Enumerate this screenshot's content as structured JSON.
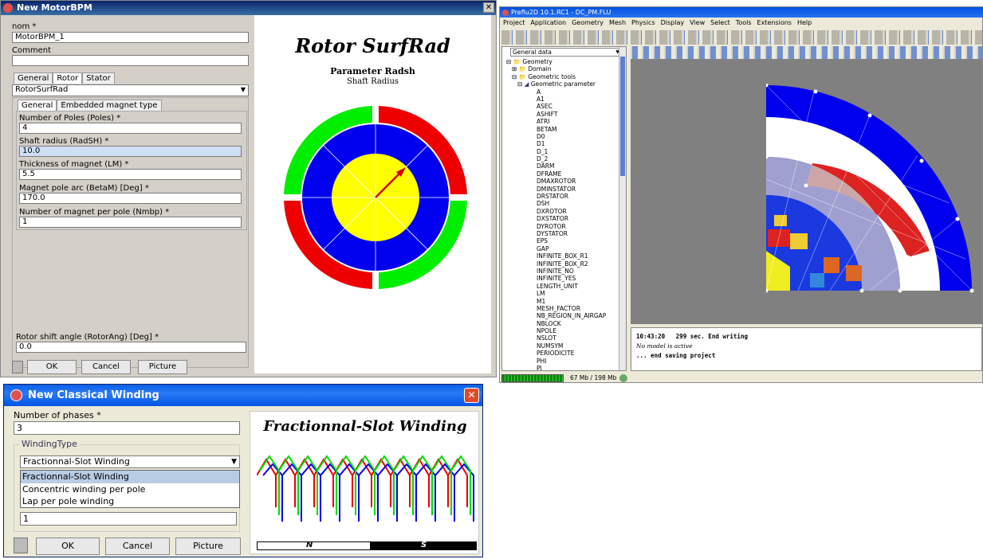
{
  "motor_dialog": {
    "title": "New MotorBPM",
    "nom_label": "nom *",
    "nom_value": "MotorBPM_1",
    "comment_label": "Comment",
    "comment_value": "",
    "tabs": [
      "General",
      "Rotor",
      "Stator"
    ],
    "rotor_type": "RotorSurfRad",
    "subtabs": [
      "General",
      "Embedded magnet type"
    ],
    "fields": [
      {
        "label": "Number of Poles (Poles) *",
        "value": "4"
      },
      {
        "label": "Shaft radius (RadSH) *",
        "value": "10.0"
      },
      {
        "label": "Thickness of magnet (LM) *",
        "value": "5.5"
      },
      {
        "label": "Magnet pole arc (BetaM) [Deg] *",
        "value": "170.0"
      },
      {
        "label": "Number of magnet per pole (Nmbp) *",
        "value": "1"
      }
    ],
    "shift_label": "Rotor shift angle (RotorAng) [Deg] *",
    "shift_value": "0.0",
    "ok": "OK",
    "cancel": "Cancel",
    "picture": "Picture",
    "preview_title": "Rotor SurfRad",
    "param_title": "Parameter Radsh",
    "param_sub": "Shaft Radius",
    "colors": {
      "red": "#ee0000",
      "green": "#00ee00",
      "blue": "#0000ee",
      "yellow": "#ffff00"
    }
  },
  "preflu": {
    "title": "Preflu2D 10.1.RC1 - DC_PM.FLU",
    "menu": [
      "Project",
      "Application",
      "Geometry",
      "Mesh",
      "Physics",
      "Display",
      "View",
      "Select",
      "Tools",
      "Extensions",
      "Help"
    ],
    "tree_header": "General data",
    "tree_top": [
      "Geometry",
      "Domain",
      "Geometric tools",
      "Geometric parameter"
    ],
    "params": [
      "A",
      "A1",
      "ASEC",
      "ASHIFT",
      "ATRI",
      "BETAM",
      "D0",
      "D1",
      "D_1",
      "D_2",
      "DARM",
      "DFRAME",
      "DMAXROTOR",
      "DMINSTATOR",
      "DRSTATOR",
      "DSH",
      "DXROTOR",
      "DXSTATOR",
      "DYROTOR",
      "DYSTATOR",
      "EPS",
      "GAP",
      "INFINITE_BOX_R1",
      "INFINITE_BOX_R2",
      "INFINITE_NO",
      "INFINITE_YES",
      "LENGTH_UNIT",
      "LM",
      "M1",
      "MESH_FACTOR",
      "NB_REGION_IN_AIRGAP",
      "NBLOCK",
      "NPOLE",
      "NSLOT",
      "NUMSYM",
      "PERIODICITE",
      "PHI",
      "PI"
    ],
    "console": [
      {
        "time": "10:43:20",
        "text": "299 sec. End writing"
      },
      {
        "time": "",
        "text": "No model is active"
      },
      {
        "time": "",
        "text": "... end saving project"
      }
    ],
    "memory": "67 Mb / 198 Mb"
  },
  "winding_dialog": {
    "title": "New Classical Winding",
    "phases_label": "Number of phases *",
    "phases_value": "3",
    "group_label": "WindingType",
    "selected": "Fractionnal-Slot Winding",
    "options": [
      "Fractionnal-Slot Winding",
      "Concentric winding per pole",
      "Lap per pole winding"
    ],
    "hidden_value": "1",
    "ok": "OK",
    "cancel": "Cancel",
    "picture": "Picture",
    "preview_title": "Fractionnal-Slot Winding",
    "n_label": "N",
    "s_label": "S"
  }
}
